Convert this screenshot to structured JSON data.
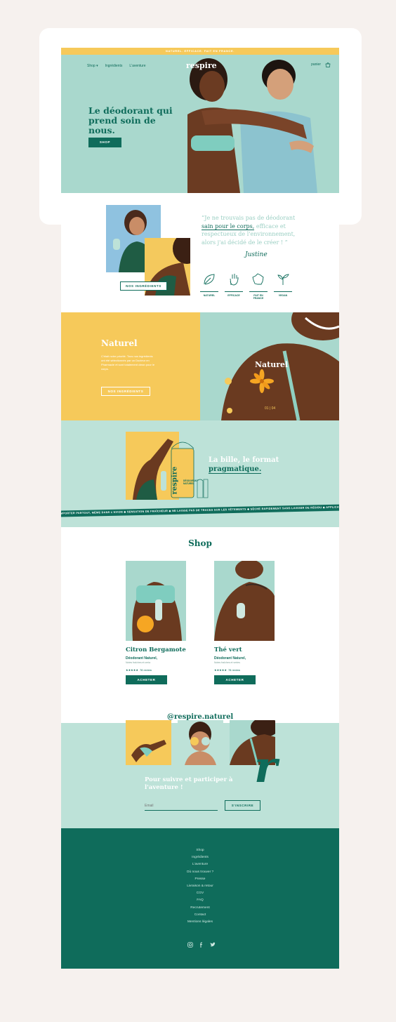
{
  "banner": "NATUREL. EFFICACE. FAIT EN FRANCE.",
  "nav": {
    "shop_label": "Shop",
    "ingredients_label": "Ingrédients",
    "aventure_label": "L'aventure",
    "logo": "respire",
    "account_label": "panier"
  },
  "hero": {
    "headline": "Le déodorant qui prend soin de nous.",
    "cta": "SHOP"
  },
  "quote": {
    "open_mark": "“",
    "text_before": "Je ne trouvais pas de déodorant ",
    "highlight": "sain pour le corps,",
    "text_after": " efficace et respectueux de l'environnement, alors j'ai décidé de le créer !",
    "close_mark": " ”",
    "signature": "Justine",
    "ingredients_button": "NOS INGRÉDIENTS",
    "badges": [
      {
        "label": "NATUREL",
        "icon": "leaf-icon"
      },
      {
        "label": "EFFICACE",
        "icon": "hand-icon"
      },
      {
        "label": "FAIT EN FRANCE",
        "icon": "france-map-icon"
      },
      {
        "label": "VEGAN",
        "icon": "sprout-icon"
      }
    ]
  },
  "naturel": {
    "title": "Naturel",
    "body": "C'était notre priorité. Tous nos ingrédients ont été sélectionnés par un Docteur en Pharmacie et sont totalement clean pour le corps.",
    "button": "NOS INGRÉDIENTS",
    "image_label": "Naturel",
    "pager_current": "01",
    "pager_total": "04",
    "pager_sep": " | "
  },
  "bille": {
    "title_plain": "La bille, le format",
    "title_highlight": "pragmatique.",
    "product_brand": "respire",
    "product_line1": "DÉODORANT",
    "product_line2": "NATUREL",
    "ticker": "EMPORTER PARTOUT, MÊME DANS L'AVION  ◆  SENSATION DE FRAÎCHEUR  ◆  NE LAISSE PAS DE TRACES SUR LES VÊTEMENTS  ◆  SÈCHE RAPIDEMENT SANS LAISSER DE RÉSIDU  ◆  APPLICATION RAPIDE ET FACILE"
  },
  "shop": {
    "title": "Shop",
    "products": [
      {
        "name": "Citron Bergamote",
        "subtitle": "Déodorant Naturel,",
        "note": "Notes fraîches et ceria",
        "stars": "★★★★★",
        "reviews": "78 review",
        "button": "ACHETER"
      },
      {
        "name": "Thé vert",
        "subtitle": "Déodorant Naturel,",
        "note": "Notes fraîches et vertes",
        "stars": "★★★★★",
        "reviews": "78 review",
        "button": "ACHETER"
      }
    ]
  },
  "instagram": {
    "handle": "@respire.naturel",
    "letter": "r"
  },
  "newsletter": {
    "title": "Pour suivre et participer à l'aventure !",
    "email_placeholder": "Email",
    "button": "S'INSCRIRE"
  },
  "footer": {
    "links": [
      "Shop",
      "Ingrédients",
      "L'aventure",
      "Où nous trouver ?",
      "Presse",
      "Livraison & retour",
      "CGV",
      "FAQ",
      "Recrutement",
      "Contact",
      "Mentions légales"
    ],
    "social": [
      "instagram-icon",
      "facebook-icon",
      "twitter-icon"
    ]
  },
  "colors": {
    "brand_green": "#0f6c5b",
    "mint": "#a9d8cd",
    "light_mint": "#bde2d8",
    "yellow": "#f6c95a",
    "page_bg": "#f6f1ee"
  }
}
